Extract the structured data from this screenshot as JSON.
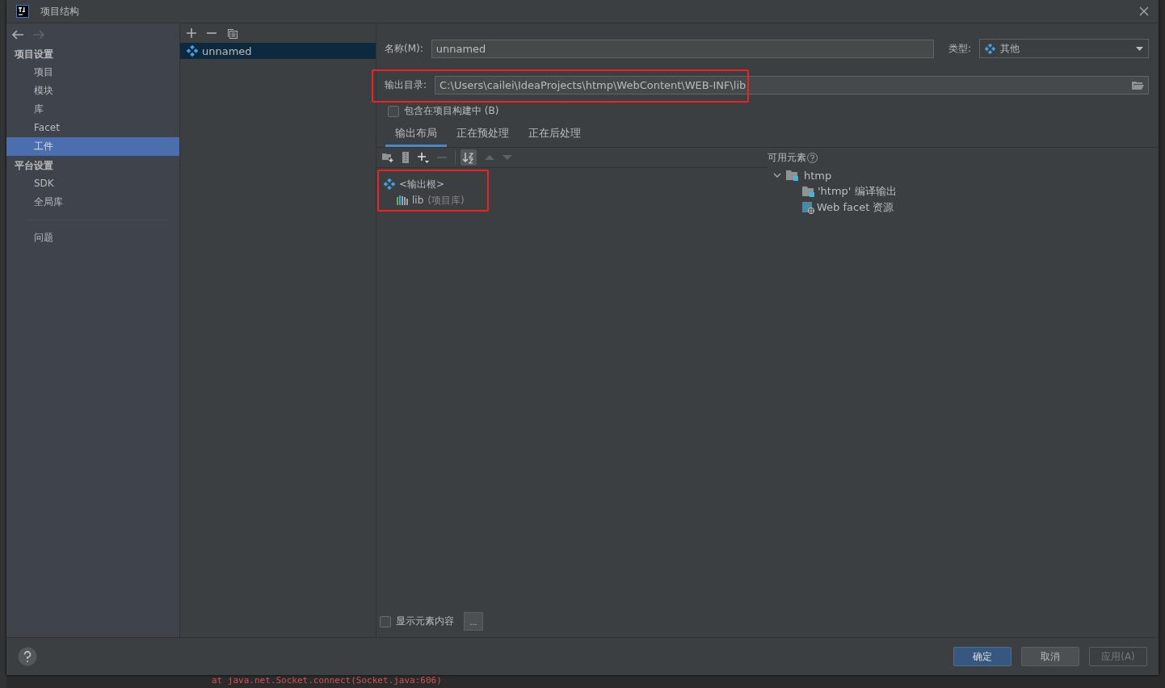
{
  "window": {
    "title": "项目结构"
  },
  "nav": [
    {
      "kind": "back",
      "disabled": false
    },
    {
      "kind": "forward",
      "disabled": true
    }
  ],
  "sidebar": {
    "sections": [
      {
        "title": "项目设置",
        "items": [
          {
            "label": "项目",
            "selected": false
          },
          {
            "label": "模块",
            "selected": false
          },
          {
            "label": "库",
            "selected": false
          },
          {
            "label": "Facet",
            "selected": false
          },
          {
            "label": "工件",
            "selected": true
          }
        ]
      },
      {
        "title": "平台设置",
        "items": [
          {
            "label": "SDK",
            "selected": false
          },
          {
            "label": "全局库",
            "selected": false
          }
        ]
      }
    ],
    "extra_items": [
      {
        "label": "问题",
        "selected": false
      }
    ]
  },
  "artifacts": [
    {
      "name": "unnamed",
      "selected": true
    }
  ],
  "form": {
    "name_label": "名称(M):",
    "name_value": "unnamed",
    "type_label": "类型:",
    "type_value": "其他",
    "output_dir_label": "输出目录:",
    "output_dir_value": "C:\\Users\\cailei\\IdeaProjects\\htmp\\WebContent\\WEB-INF\\lib",
    "output_dir_highlight": true,
    "include_in_build": {
      "label": "包含在项目构建中 (B)",
      "checked": false
    }
  },
  "tabs": [
    {
      "label": "输出布局",
      "selected": true
    },
    {
      "label": "正在预处理",
      "selected": false
    },
    {
      "label": "正在后处理",
      "selected": false
    }
  ],
  "layout_tree": {
    "highlight": true,
    "nodes": [
      {
        "kind": "root",
        "label": "<输出根>",
        "children": [
          {
            "kind": "library",
            "label": "lib",
            "note": "(项目库)"
          }
        ]
      }
    ]
  },
  "available": {
    "title": "可用元素",
    "nodes": [
      {
        "kind": "module",
        "label": "htmp",
        "expanded": true,
        "children": [
          {
            "kind": "compile_output",
            "label": "'htmp' 编译输出"
          },
          {
            "kind": "web_facet",
            "label": "Web facet 资源"
          }
        ]
      }
    ]
  },
  "show_content": {
    "label": "显示元素内容",
    "checked": false
  },
  "more_button": "...",
  "buttons": [
    {
      "label": "确定",
      "kind": "primary",
      "disabled": false
    },
    {
      "label": "取消",
      "kind": "normal",
      "disabled": false
    },
    {
      "label": "应用(A)",
      "kind": "normal",
      "disabled": true
    }
  ],
  "background_text": "at java.net.Socket.connect(Socket.java:606)"
}
